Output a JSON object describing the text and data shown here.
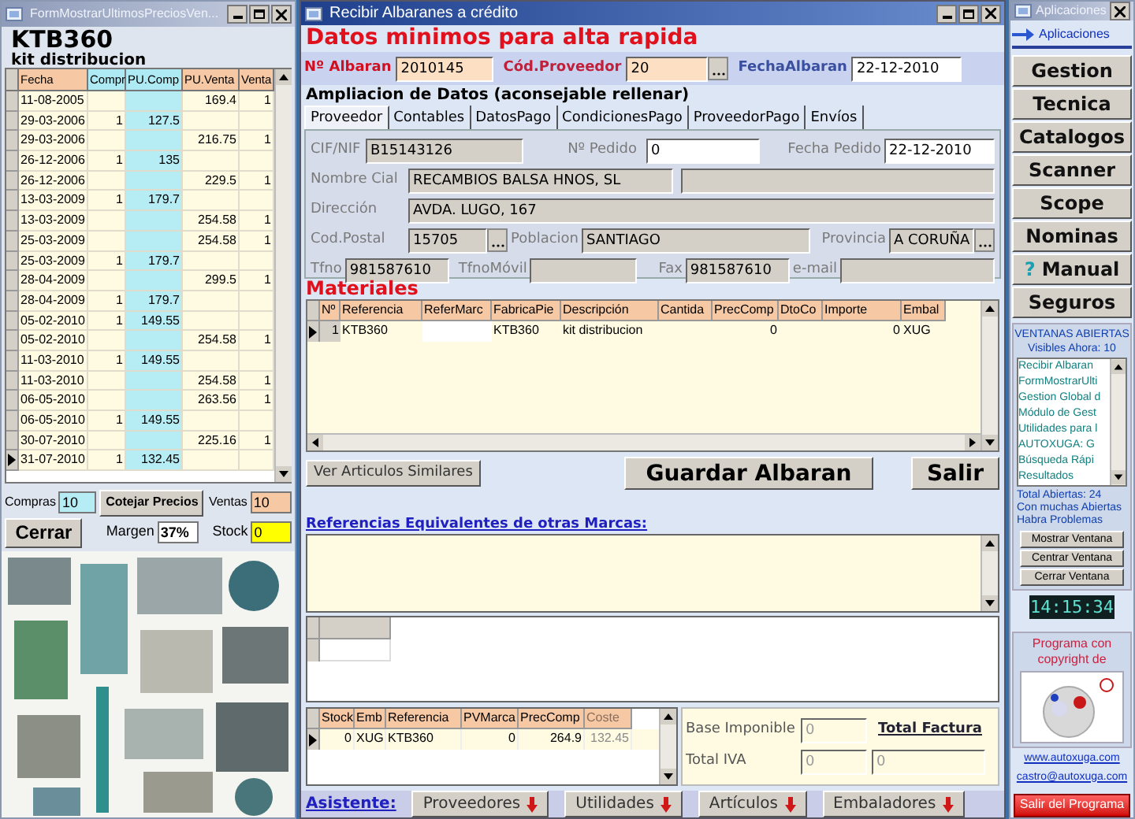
{
  "left_window": {
    "title": "FormMostrarUltimosPreciosVen...",
    "code": "KTB360",
    "description": "kit distribucion",
    "grid": {
      "columns": [
        "Fecha",
        "Compr",
        "PU.Comp",
        "PU.Venta",
        "Venta"
      ],
      "rows": [
        {
          "cells": [
            "11-08-2005",
            "",
            "",
            "169.4",
            "1"
          ],
          "selected": false
        },
        {
          "cells": [
            "29-03-2006",
            "1",
            "127.5",
            "",
            ""
          ],
          "selected": false
        },
        {
          "cells": [
            "29-03-2006",
            "",
            "",
            "216.75",
            "1"
          ],
          "selected": false
        },
        {
          "cells": [
            "26-12-2006",
            "1",
            "135",
            "",
            ""
          ],
          "selected": false
        },
        {
          "cells": [
            "26-12-2006",
            "",
            "",
            "229.5",
            "1"
          ],
          "selected": false
        },
        {
          "cells": [
            "13-03-2009",
            "1",
            "179.7",
            "",
            ""
          ],
          "selected": false
        },
        {
          "cells": [
            "13-03-2009",
            "",
            "",
            "254.58",
            "1"
          ],
          "selected": false
        },
        {
          "cells": [
            "25-03-2009",
            "",
            "",
            "254.58",
            "1"
          ],
          "selected": false
        },
        {
          "cells": [
            "25-03-2009",
            "1",
            "179.7",
            "",
            ""
          ],
          "selected": false
        },
        {
          "cells": [
            "28-04-2009",
            "",
            "",
            "299.5",
            "1"
          ],
          "selected": false
        },
        {
          "cells": [
            "28-04-2009",
            "1",
            "179.7",
            "",
            ""
          ],
          "selected": false
        },
        {
          "cells": [
            "05-02-2010",
            "1",
            "149.55",
            "",
            ""
          ],
          "selected": false
        },
        {
          "cells": [
            "05-02-2010",
            "",
            "",
            "254.58",
            "1"
          ],
          "selected": false
        },
        {
          "cells": [
            "11-03-2010",
            "1",
            "149.55",
            "",
            ""
          ],
          "selected": false
        },
        {
          "cells": [
            "11-03-2010",
            "",
            "",
            "254.58",
            "1"
          ],
          "selected": false
        },
        {
          "cells": [
            "06-05-2010",
            "",
            "",
            "263.56",
            "1"
          ],
          "selected": false
        },
        {
          "cells": [
            "06-05-2010",
            "1",
            "149.55",
            "",
            ""
          ],
          "selected": false
        },
        {
          "cells": [
            "30-07-2010",
            "",
            "",
            "225.16",
            "1"
          ],
          "selected": false
        },
        {
          "cells": [
            "31-07-2010",
            "1",
            "132.45",
            "",
            ""
          ],
          "selected": true
        }
      ]
    },
    "compras_label": "Compras",
    "compras": "10",
    "cotejar_button": "Cotejar Precios",
    "ventas_label": "Ventas",
    "ventas": "10",
    "cerrar_button": "Cerrar",
    "margen_label": "Margen",
    "margen": "37%",
    "stock_label": "Stock",
    "stock": "0"
  },
  "main_window": {
    "title": "Recibir Albaranes a crédito",
    "heading": "Datos minimos para alta rapida",
    "albaran": {
      "label": "Nº Albaran",
      "value": "2010145"
    },
    "proveedor": {
      "label": "Cód.Proveedor",
      "value": "20"
    },
    "fecha_albaran": {
      "label": "FechaAlbaran",
      "value": "22-12-2010"
    },
    "section": "Ampliacion de Datos (aconsejable rellenar)",
    "tabs": [
      {
        "label": "Proveedor",
        "selected": true
      },
      {
        "label": "Contables",
        "selected": false
      },
      {
        "label": "DatosPago",
        "selected": false
      },
      {
        "label": "CondicionesPago",
        "selected": false
      },
      {
        "label": "ProveedorPago",
        "selected": false
      },
      {
        "label": "Envíos",
        "selected": false
      }
    ],
    "cif": {
      "label": "CIF/NIF",
      "value": "B15143126"
    },
    "pedido": {
      "label": "Nº Pedido",
      "value": "0"
    },
    "fecha_pedido": {
      "label": "Fecha Pedido",
      "value": "22-12-2010"
    },
    "nombre": {
      "label": "Nombre Cial",
      "value": "RECAMBIOS BALSA HNOS, SL"
    },
    "direccion": {
      "label": "Dirección",
      "value": "AVDA. LUGO, 167"
    },
    "cod_postal": {
      "label": "Cod.Postal",
      "value": "15705"
    },
    "poblacion": {
      "label": "Poblacion",
      "value": "SANTIAGO"
    },
    "provincia": {
      "label": "Provincia",
      "value": "A CORUÑA"
    },
    "tfno": {
      "label": "Tfno",
      "value": "981587610"
    },
    "movil": {
      "label": "TfnoMóvil"
    },
    "fax": {
      "label": "Fax",
      "value": "981587610"
    },
    "email": {
      "label": "e-mail"
    },
    "materiales": {
      "title": "Materiales",
      "columns": [
        "Nº",
        "Referencia",
        "ReferMarc",
        "FabricaPie",
        "Descripción",
        "Cantida",
        "PrecComp",
        "DtoCo",
        "Importe",
        "Embal"
      ],
      "rows": [
        {
          "cells": [
            "1",
            "KTB360",
            "",
            "KTB360",
            "kit distribucion",
            "",
            "0",
            "",
            "0",
            "XUG"
          ],
          "selected": true
        }
      ]
    },
    "similares_button": "Ver Articulos Similares",
    "guardar_button": "Guardar Albaran",
    "salir_button": "Salir",
    "equivalentes_label": "Referencias Equivalentes de otras Marcas:",
    "stock_grid": {
      "columns": [
        {
          "label": "Stock",
          "dimmed": false
        },
        {
          "label": "Emb",
          "dimmed": false
        },
        {
          "label": "Referencia",
          "dimmed": false
        },
        {
          "label": "PVMarca",
          "dimmed": false
        },
        {
          "label": "PrecComp",
          "dimmed": false
        },
        {
          "label": "Coste",
          "dimmed": true
        }
      ],
      "rows": [
        {
          "cells": [
            "0",
            "XUG",
            "KTB360",
            "0",
            "264.9",
            "132.45"
          ],
          "selected": true
        }
      ]
    },
    "base_label": "Base Imponible",
    "base": "0",
    "total_factura": "Total Factura",
    "iva_label": "Total IVA",
    "iva": "0",
    "total": "0",
    "asistente": {
      "label": "Asistente:",
      "buttons": [
        "Proveedores",
        "Utilidades",
        "Artículos",
        "Embaladores"
      ]
    }
  },
  "apps_window": {
    "title": "Aplicaciones",
    "link": "Aplicaciones",
    "buttons": [
      {
        "label": "Gestion"
      },
      {
        "label": "Tecnica"
      },
      {
        "label": "Catalogos"
      },
      {
        "label": "Scanner"
      },
      {
        "label": "Scope"
      },
      {
        "label": "Nominas"
      },
      {
        "label": "Manual",
        "icon": "?"
      },
      {
        "label": "Seguros"
      }
    ],
    "open_windows": {
      "title": "VENTANAS ABIERTAS",
      "visible": "Visibles Ahora: 10",
      "items": [
        "Recibir Albaran",
        "FormMostrarUlti",
        "Gestion Global d",
        "Módulo de Gest",
        "Utilidades para l",
        "AUTOXUGA: G",
        "Búsqueda Rápi",
        "Resultados"
      ],
      "total": "Total Abiertas: 24",
      "warning": "Con muchas Abiertas Habra Problemas",
      "buttons": [
        "Mostrar Ventana",
        "Centrar Ventana",
        "Cerrar Ventana"
      ]
    },
    "clock": "14:15:34",
    "copyright": "Programa con copyright de",
    "links": [
      "www.autoxuga.com",
      "castro@autoxuga.com"
    ],
    "exit_button": "Salir del Programa"
  }
}
